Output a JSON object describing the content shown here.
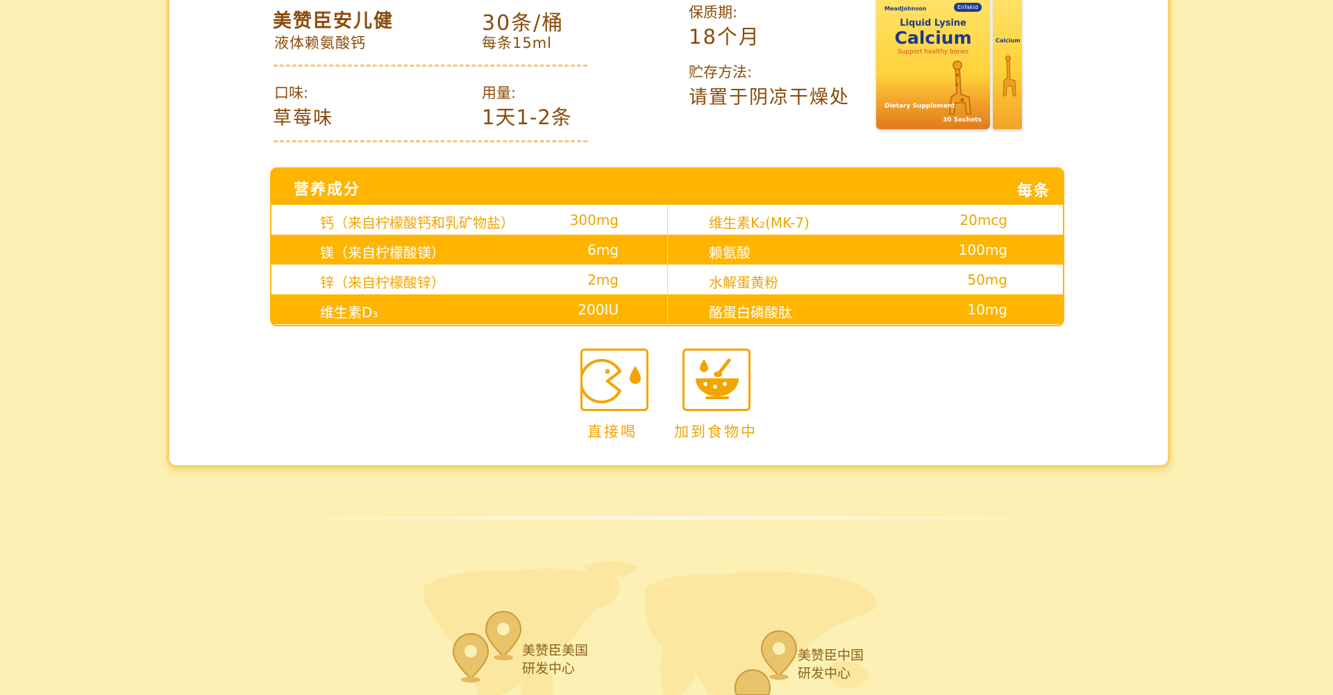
{
  "product_info": {
    "name_line1": "美赞臣安儿健",
    "name_line2": "液体赖氨酸钙",
    "spec_line1": "30条/桶",
    "spec_line2": "每条15ml",
    "flavor_label": "口味:",
    "flavor_value": "草莓味",
    "dosage_label": "用量:",
    "dosage_value": "1天1-2条",
    "shelf_life_label": "保质期:",
    "shelf_life_value": "18个月",
    "storage_label": "贮存方法:",
    "storage_value": "请置于阴凉干燥处"
  },
  "product_image": {
    "brand": "MeadJohnson",
    "badge": "Enfakid",
    "line1": "Liquid Lysine",
    "line2": "Calcium",
    "line3": "Support healthy bones",
    "label": "Dietary Supplement",
    "sachets": "30 Sachets",
    "sachet_name": "Calcium",
    "colors": {
      "can_blue": "#1b3a8c",
      "can_yellow": "#ffd23a",
      "can_orange": "#e07b1c"
    }
  },
  "nutrition": {
    "title": "营养成分",
    "per": "每条",
    "rows": [
      {
        "name1": "钙（来自柠檬酸钙和乳矿物盐）",
        "value1": "300mg",
        "name2": "维生素K₂(MK-7)",
        "value2": "20mcg"
      },
      {
        "name1": "镁（来自柠檬酸镁）",
        "value1": "6mg",
        "name2": "赖氨酸",
        "value2": "100mg"
      },
      {
        "name1": "锌（来自柠檬酸锌）",
        "value1": "2mg",
        "name2": "水解蛋黄粉",
        "value2": "50mg"
      },
      {
        "name1": "维生素D₃",
        "value1": "200IU",
        "name2": "酪蛋白磷酸肽",
        "value2": "10mg"
      }
    ]
  },
  "usage": [
    {
      "label": "直接喝",
      "icon": "drink-directly-icon"
    },
    {
      "label": "加到食物中",
      "icon": "add-to-food-icon"
    }
  ],
  "research": {
    "centers": [
      {
        "line1": "美赞臣美国",
        "line2": "研发中心"
      },
      {
        "line1": "美赞臣中国",
        "line2": "研发中心"
      }
    ]
  },
  "colors": {
    "background": "#fdf0b4",
    "accent": "#ffb400",
    "text_brown": "#8a4b0a",
    "text_orange": "#f2a400"
  }
}
